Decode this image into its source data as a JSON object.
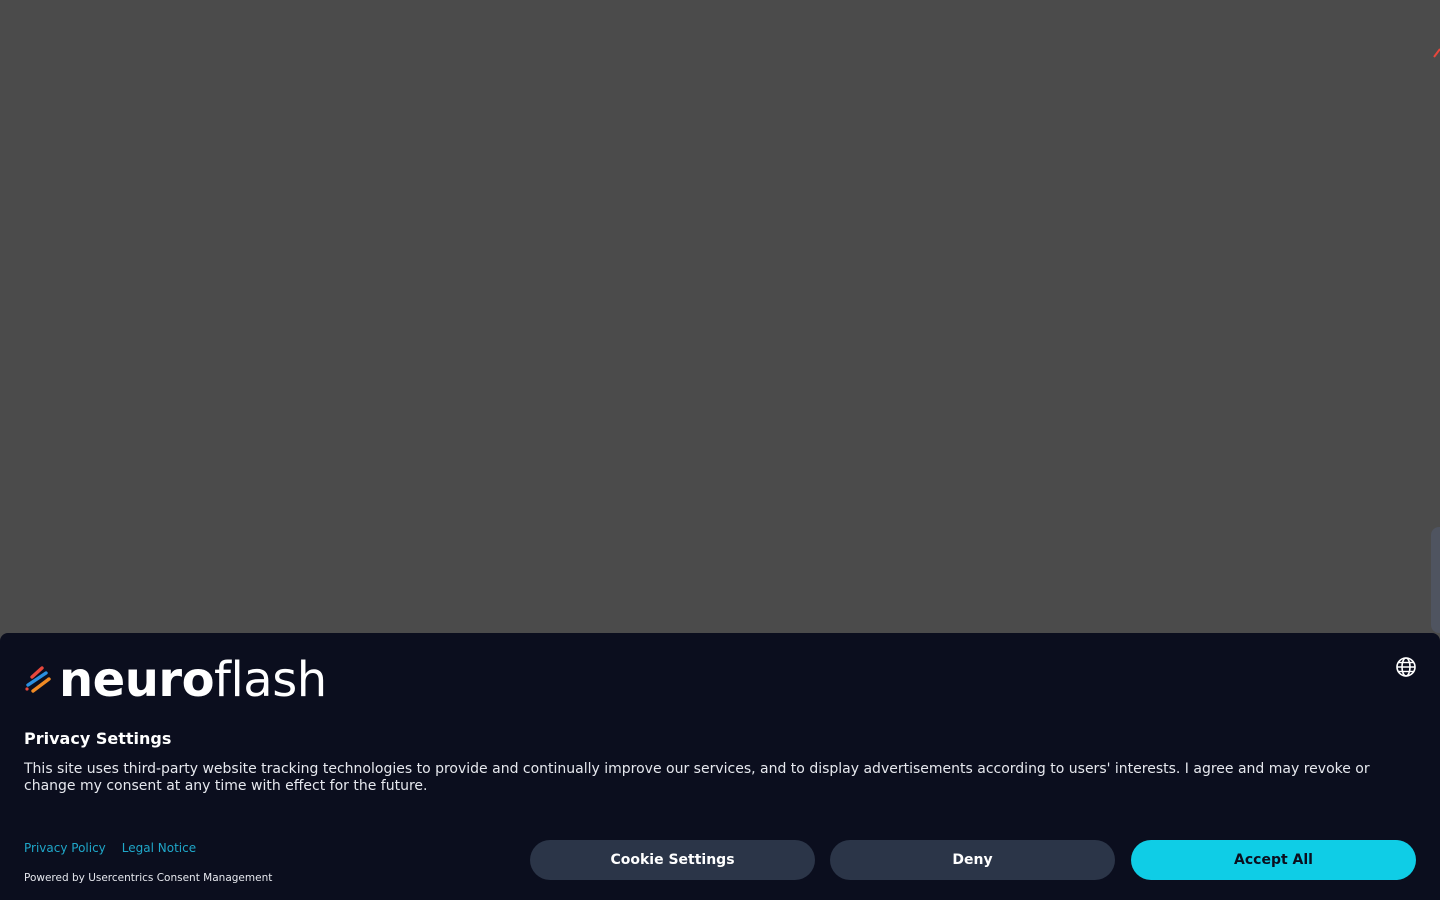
{
  "colors": {
    "backdrop": "#4b4b4b",
    "banner_bg": "#0b0e1e",
    "secondary_button": "#2b3548",
    "accept_button": "#0fcde6",
    "link": "#1fa7c9",
    "logo_red": "#e8473c",
    "logo_blue": "#2a8fe0",
    "logo_orange": "#f08a24"
  },
  "brand": {
    "logo_icon": "neuroflash-logo-icon",
    "name_bold": "neuro",
    "name_light": "flash"
  },
  "language": {
    "icon": "globe-icon"
  },
  "consent": {
    "title": "Privacy Settings",
    "description": "This site uses third-party website tracking technologies to provide and continually improve our services, and to display advertisements according to users' interests. I agree and may revoke or change my consent at any time with effect for the future.",
    "links": {
      "privacy_policy": "Privacy Policy",
      "legal_notice": "Legal Notice"
    },
    "powered_by": "Powered by Usercentrics Consent Management",
    "buttons": {
      "settings": "Cookie Settings",
      "deny": "Deny",
      "accept": "Accept All"
    }
  }
}
